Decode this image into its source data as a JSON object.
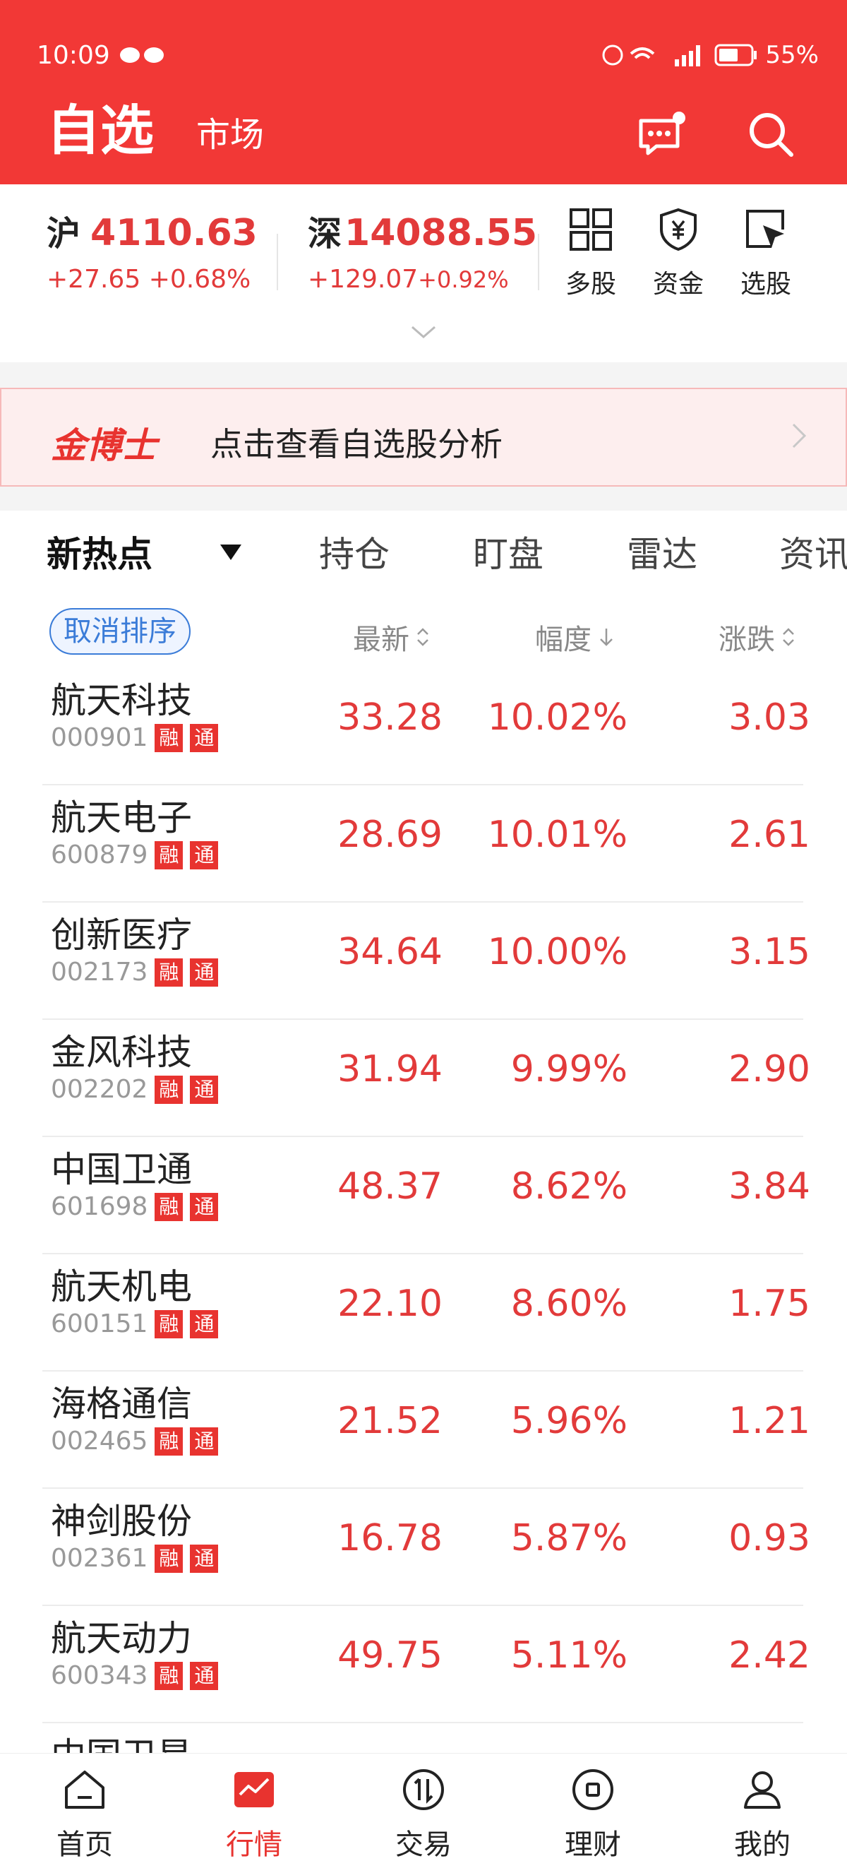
{
  "status": {
    "time": "10:09",
    "battery": "55%"
  },
  "header": {
    "title": "自选",
    "market_tab": "市场"
  },
  "indices": [
    {
      "name": "沪",
      "value": "4110.63",
      "change": "+27.65",
      "pct": "+0.68%"
    },
    {
      "name": "深",
      "value": "14088.55",
      "change": "+129.07",
      "pct": "+0.92%"
    }
  ],
  "tools": [
    {
      "label": "多股",
      "icon": "grid-icon"
    },
    {
      "label": "资金",
      "icon": "shield-yuan-icon"
    },
    {
      "label": "选股",
      "icon": "cursor-select-icon"
    }
  ],
  "banner": {
    "brand": "金博士",
    "text": "点击查看自选股分析"
  },
  "tabs": [
    "新热点",
    "持仓",
    "盯盘",
    "雷达",
    "资讯"
  ],
  "sort": {
    "cancel_label": "取消排序",
    "col_latest": "最新",
    "col_range": "幅度",
    "col_change": "涨跌"
  },
  "stocks": [
    {
      "name": "航天科技",
      "code": "000901",
      "price": "33.28",
      "pct": "10.02%",
      "change": "3.03"
    },
    {
      "name": "航天电子",
      "code": "600879",
      "price": "28.69",
      "pct": "10.01%",
      "change": "2.61"
    },
    {
      "name": "创新医疗",
      "code": "002173",
      "price": "34.64",
      "pct": "10.00%",
      "change": "3.15"
    },
    {
      "name": "金风科技",
      "code": "002202",
      "price": "31.94",
      "pct": "9.99%",
      "change": "2.90"
    },
    {
      "name": "中国卫通",
      "code": "601698",
      "price": "48.37",
      "pct": "8.62%",
      "change": "3.84"
    },
    {
      "name": "航天机电",
      "code": "600151",
      "price": "22.10",
      "pct": "8.60%",
      "change": "1.75"
    },
    {
      "name": "海格通信",
      "code": "002465",
      "price": "21.52",
      "pct": "5.96%",
      "change": "1.21"
    },
    {
      "name": "神剑股份",
      "code": "002361",
      "price": "16.78",
      "pct": "5.87%",
      "change": "0.93"
    },
    {
      "name": "航天动力",
      "code": "600343",
      "price": "49.75",
      "pct": "5.11%",
      "change": "2.42"
    },
    {
      "name": "中国卫星",
      "code": "",
      "price": "",
      "pct": "",
      "change": ""
    }
  ],
  "tags": {
    "margin": "融",
    "connect": "通"
  },
  "nav": [
    {
      "label": "首页",
      "icon": "home-icon"
    },
    {
      "label": "行情",
      "icon": "market-chart-icon"
    },
    {
      "label": "交易",
      "icon": "trade-icon"
    },
    {
      "label": "理财",
      "icon": "wealth-icon"
    },
    {
      "label": "我的",
      "icon": "profile-icon"
    }
  ],
  "colors": {
    "brand_red": "#f23836",
    "up_red": "#e23a3a",
    "link_blue": "#3b7cd8"
  }
}
